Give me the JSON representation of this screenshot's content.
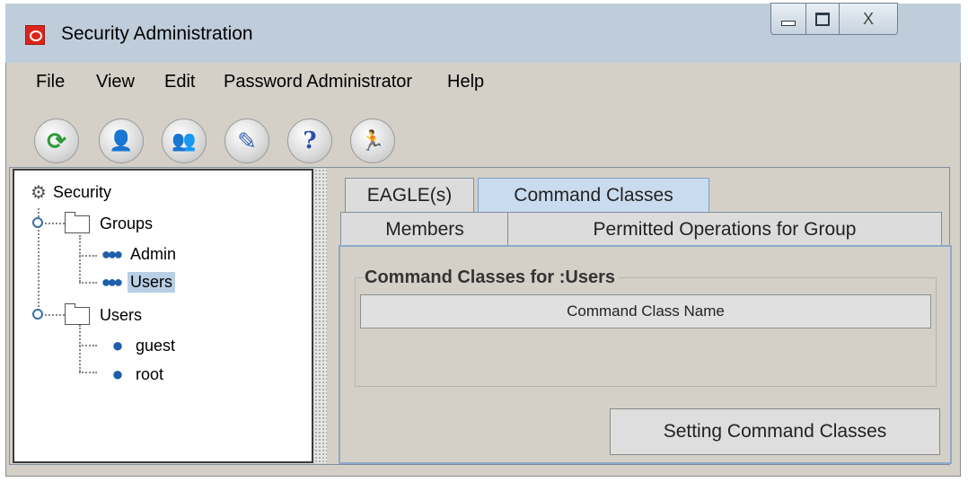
{
  "window": {
    "title": "Security Administration",
    "close_glyph": "X"
  },
  "menu": [
    {
      "label": "File"
    },
    {
      "label": "View"
    },
    {
      "label": "Edit"
    },
    {
      "label": "Password Administrator"
    },
    {
      "label": "Help"
    }
  ],
  "toolbar": [
    {
      "icon": "refresh-icon",
      "glyph": "⟳",
      "color": "#2e9a3a"
    },
    {
      "icon": "add-user-icon",
      "glyph": "👤",
      "color": "#c99a1c"
    },
    {
      "icon": "add-group-icon",
      "glyph": "👥",
      "color": "#c99a1c"
    },
    {
      "icon": "edit-user-icon",
      "glyph": "✎",
      "color": "#3a64b0"
    },
    {
      "icon": "help-icon",
      "glyph": "?",
      "color": "#2a4fb0"
    },
    {
      "icon": "exit-icon",
      "glyph": "🏃",
      "color": "#d77a14"
    }
  ],
  "tree": {
    "root": "Security",
    "groups_label": "Groups",
    "groups": [
      "Admin",
      "Users"
    ],
    "selected": "Users",
    "users_label": "Users",
    "users": [
      "guest",
      "root"
    ]
  },
  "tabs": {
    "row1": [
      "EAGLE(s)",
      "Command Classes"
    ],
    "row2": [
      "Members",
      "Permitted Operations for Group"
    ],
    "active": "Command Classes"
  },
  "panel": {
    "group_title": "Command Classes for :Users",
    "column_header": "Command Class Name",
    "action_button": "Setting Command Classes"
  }
}
